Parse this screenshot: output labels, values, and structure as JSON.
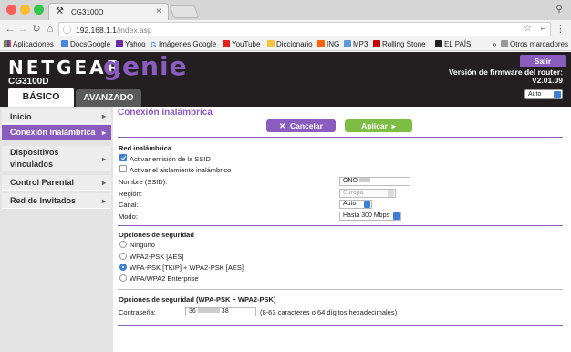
{
  "browser": {
    "tab_title": "CG3100D",
    "url_host": "192.168.1.1",
    "url_path": "/index.asp",
    "bookmarks": [
      "Aplicaciones",
      "DocsGoogle",
      "Yahoo",
      "Imágenes Google",
      "YouTube",
      "Diccionario",
      "ING",
      "MP3",
      "Rolling Stone",
      "EL PAÍS"
    ],
    "other_bookmarks": "Otros marcadores",
    "overflow": "»"
  },
  "header": {
    "logo": "NETGEAR",
    "genie": "genie",
    "model": "CG3100D",
    "logout": "Salir",
    "fw_label": "Versión de firmware del router:",
    "fw_version": "V2.01.09",
    "tab_basic": "BÁSICO",
    "tab_advanced": "AVANZADO",
    "language": "Auto"
  },
  "sidebar": {
    "items": [
      {
        "label": "Inicio"
      },
      {
        "label": "Conexión inalámbrica"
      },
      {
        "label": "Dispositivos vinculados"
      },
      {
        "label": "Control Parental"
      },
      {
        "label": "Red de Invitados"
      }
    ]
  },
  "main": {
    "title": "Conexión inalámbrica",
    "cancel": "Cancelar",
    "apply": "Aplicar",
    "wireless": {
      "heading": "Red inalámbrica",
      "enable_ssid": "Activar emisión de la SSID",
      "enable_isolation": "Activar el aislamiento inalámbrico",
      "ssid_label": "Nombre (SSID):",
      "ssid_value": "ONO",
      "region_label": "Región:",
      "region_value": "Europa",
      "channel_label": "Canal:",
      "channel_value": "Auto",
      "mode_label": "Modo:",
      "mode_value": "Hasta 300 Mbps"
    },
    "security": {
      "heading": "Opciones de seguridad",
      "options": [
        "Ninguno",
        "WPA2-PSK [AES]",
        "WPA-PSK [TKIP] + WPA2-PSK [AES]",
        "WPA/WPA2 Enterprise"
      ],
      "selected": 2
    },
    "wpa": {
      "heading": "Opciones de seguridad (WPA-PSK + WPA2-PSK)",
      "password_label": "Contraseña:",
      "password_value_start": "36",
      "password_value_end": "38",
      "hint": "(8-63 caracteres o 64 dígitos hexadecimales)"
    }
  },
  "colors": {
    "accent": "#8a5cbf",
    "apply": "#7ebd43",
    "header_bg": "#231f20"
  }
}
